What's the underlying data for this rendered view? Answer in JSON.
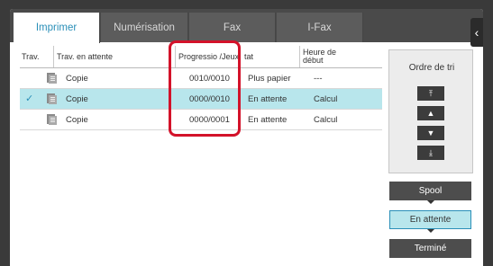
{
  "tabs": [
    {
      "label": "Imprimer",
      "active": true
    },
    {
      "label": "Numérisation",
      "active": false
    },
    {
      "label": "Fax",
      "active": false
    },
    {
      "label": "I-Fax",
      "active": false
    }
  ],
  "collapse_glyph": "‹",
  "table": {
    "headers": {
      "trav": "Trav.",
      "trav_attente": "Trav. en attente",
      "progression": "Progressio /Jeux",
      "etat": "tat",
      "heure_line1": "Heure de",
      "heure_line2": "début"
    },
    "rows": [
      {
        "job": "Copie",
        "progress": "0010/0010",
        "status": "Plus papier",
        "start": "---",
        "selected": false
      },
      {
        "job": "Copie",
        "progress": "0000/0010",
        "status": "En attente",
        "start": "Calcul",
        "selected": true
      },
      {
        "job": "Copie",
        "progress": "0000/0001",
        "status": "En attente",
        "start": "Calcul",
        "selected": false
      }
    ]
  },
  "sort": {
    "title": "Ordre de tri",
    "buttons": [
      {
        "name": "sort-first-button",
        "glyph": "⤒"
      },
      {
        "name": "sort-up-button",
        "glyph": "▲"
      },
      {
        "name": "sort-down-button",
        "glyph": "▼"
      },
      {
        "name": "sort-last-button",
        "glyph": "⤓"
      }
    ]
  },
  "filters": [
    {
      "label": "Spool",
      "selected": false
    },
    {
      "label": "En attente",
      "selected": true
    },
    {
      "label": "Terminé",
      "selected": false
    }
  ],
  "colors": {
    "accent": "#2a8fb8",
    "selected_row": "#b8e6ec",
    "highlight": "#d3122a"
  },
  "icons": [
    "copy-job-icon",
    "check-icon",
    "chevron-left-icon"
  ]
}
